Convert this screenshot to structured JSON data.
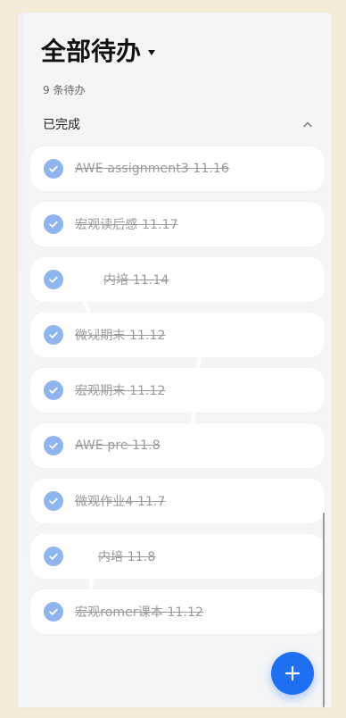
{
  "header": {
    "title": "全部待办",
    "count": "9 条待办"
  },
  "section": {
    "title": "已完成"
  },
  "items": [
    {
      "text": "AWE assignment3 11.16"
    },
    {
      "text": "宏观读后感 11.17"
    },
    {
      "text": "内培 11.14"
    },
    {
      "text": "微观期末 11.12"
    },
    {
      "text": "宏观期末 11.12"
    },
    {
      "text": "AWE pre 11.8"
    },
    {
      "text": "微观作业4 11.7"
    },
    {
      "text": "内培 11.8"
    },
    {
      "text": "宏观romer课本 11.12"
    }
  ],
  "icons": {
    "dropdown": "caret-down-icon",
    "collapse": "chevron-up-icon",
    "checked": "checkmark-icon",
    "add": "plus-icon"
  },
  "colors": {
    "accent": "#1f6ff2",
    "check_fill": "#8fb5ef",
    "completed_text": "#9a9a9a"
  }
}
